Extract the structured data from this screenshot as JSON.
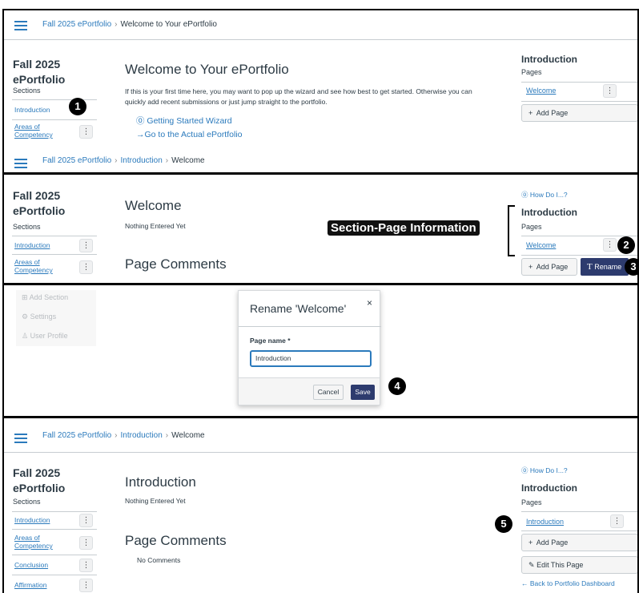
{
  "p1": {
    "crumb_portfolio": "Fall 2025 ePortfolio",
    "crumb_current": "Welcome to Your ePortfolio",
    "side_title": "Fall 2025 ePortfolio",
    "sections_label": "Sections",
    "sections": [
      "Introduction",
      "Areas of Competency"
    ],
    "heading": "Welcome to Your ePortfolio",
    "intro": "If this is your first time here, you may want to pop up the wizard and see how best to get started. Otherwise you can quickly add recent submissions or just jump straight to the portfolio.",
    "wizard_link": "Getting Started Wizard",
    "goto_link": "Go to the Actual ePortfolio",
    "right_title": "Introduction",
    "pages_label": "Pages",
    "pages": [
      "Welcome"
    ],
    "add_page": "Add Page",
    "badge": "1"
  },
  "p2": {
    "crumb_portfolio": "Fall 2025 ePortfolio",
    "crumb_section": "Introduction",
    "crumb_page": "Welcome",
    "side_title": "Fall 2025 ePortfolio",
    "sections_label": "Sections",
    "sections": [
      "Introduction",
      "Areas of Competency"
    ],
    "heading": "Welcome",
    "subtext": "Nothing Entered Yet",
    "comments_heading": "Page Comments",
    "annotation": "Section-Page Information",
    "how_do_i": "How Do I...?",
    "right_title": "Introduction",
    "pages_label": "Pages",
    "pages": [
      "Welcome"
    ],
    "add_page": "Add Page",
    "rename_menu": "Rename",
    "badge2": "2",
    "badge3": "3"
  },
  "p3": {
    "side_items": [
      "Add Section",
      "Settings",
      "User Profile"
    ],
    "dialog_title": "Rename 'Welcome'",
    "field_label": "Page name *",
    "field_value": "Introduction",
    "cancel": "Cancel",
    "save": "Save",
    "badge": "4"
  },
  "p4": {
    "crumb_portfolio": "Fall 2025 ePortfolio",
    "crumb_section": "Introduction",
    "crumb_page": "Welcome",
    "side_title": "Fall 2025 ePortfolio",
    "sections_label": "Sections",
    "sections": [
      "Introduction",
      "Areas of Competency",
      "Conclusion",
      "Affirmation"
    ],
    "heading": "Introduction",
    "subtext": "Nothing Entered Yet",
    "comments_heading": "Page Comments",
    "no_comments": "No Comments",
    "how_do_i": "How Do I...?",
    "right_title": "Introduction",
    "pages_label": "Pages",
    "pages": [
      "Introduction"
    ],
    "add_page": "Add Page",
    "edit_page": "Edit This Page",
    "back_link": "Back to Portfolio Dashboard",
    "badge": "5"
  },
  "colors": {
    "link": "#2b7abc",
    "button_primary": "#2d3b6e",
    "text": "#2d3b45"
  }
}
